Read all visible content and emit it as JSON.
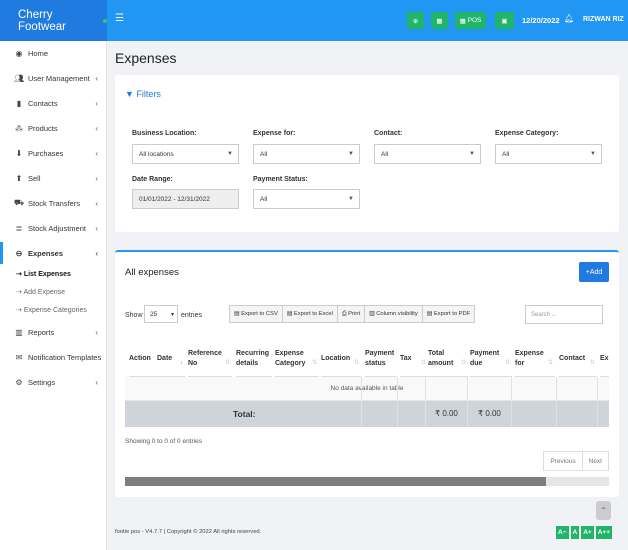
{
  "app": {
    "brand": "Cherry Footwear"
  },
  "topbar": {
    "menu_icon": "hamburger-icon",
    "btn_pos": "POS",
    "date": "12/20/2022",
    "user": "RIZWAN RIZ"
  },
  "sidebar": {
    "items": [
      {
        "label": "Home",
        "icon": "dashboard-icon"
      },
      {
        "label": "User Management",
        "icon": "users-icon"
      },
      {
        "label": "Contacts",
        "icon": "address-book-icon"
      },
      {
        "label": "Products",
        "icon": "cubes-icon"
      },
      {
        "label": "Purchases",
        "icon": "arrow-circle-down-icon"
      },
      {
        "label": "Sell",
        "icon": "arrow-circle-up-icon"
      },
      {
        "label": "Stock Transfers",
        "icon": "truck-icon"
      },
      {
        "label": "Stock Adjustment",
        "icon": "database-icon"
      },
      {
        "label": "Expenses",
        "icon": "minus-circle-icon"
      },
      {
        "label": "Reports",
        "icon": "bar-chart-icon"
      },
      {
        "label": "Notification Templates",
        "icon": "envelope-icon"
      },
      {
        "label": "Settings",
        "icon": "cog-icon"
      }
    ],
    "sub_items": [
      "List Expenses",
      "Add Expense",
      "Expense Categories"
    ]
  },
  "page": {
    "title": "Expenses"
  },
  "filters": {
    "title": "Filters",
    "business_location": {
      "label": "Business Location:",
      "value": "All locations"
    },
    "expense_for": {
      "label": "Expense for:",
      "value": "All"
    },
    "contact": {
      "label": "Contact:",
      "value": "All"
    },
    "expense_category": {
      "label": "Expense Category:",
      "value": "All"
    },
    "date_range": {
      "label": "Date Range:",
      "value": "01/01/2022 - 12/31/2022"
    },
    "payment_status": {
      "label": "Payment Status:",
      "value": "All"
    }
  },
  "expenses": {
    "title": "All expenses",
    "add_label": "Add",
    "show_label": "Show",
    "entries_label": "entries",
    "page_length": "25",
    "buttons": [
      "Export to CSV",
      "Export to Excel",
      "Print",
      "Column visibility",
      "Export to PDF"
    ],
    "search_placeholder": "Search ...",
    "columns": [
      "Action",
      "Date",
      "Reference No",
      "Recurring details",
      "Expense Category",
      "Location",
      "Payment status",
      "Tax",
      "Total amount",
      "Payment due",
      "Expense for",
      "Contact",
      "Ex no"
    ],
    "no_data": "No data available in table",
    "total_label": "Total:",
    "total_amount": "₹ 0.00",
    "total_due": "₹ 0.00",
    "showing": "Showing 0 to 0 of 0 entries",
    "prev_label": "Previous",
    "next_label": "Next"
  },
  "footer": {
    "text": "footie pos - V4.7.7 | Copyright © 2022 All rights reserved.",
    "font_buttons": [
      "A−",
      "A",
      "A+",
      "A++"
    ]
  }
}
